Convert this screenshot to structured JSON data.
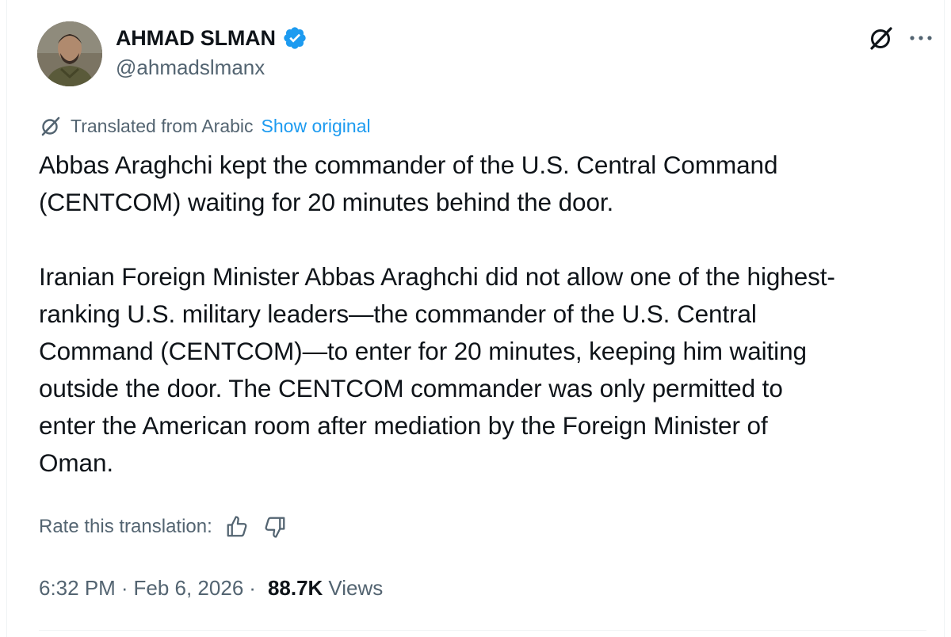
{
  "author": {
    "display_name": "AHMAD SLMAN",
    "handle": "@ahmadslmanx",
    "verified": true,
    "verified_color": "#1d9bf0"
  },
  "header_actions": {
    "grok_icon": "grok-icon",
    "more_icon": "more-horizontal-icon",
    "more_label": "···"
  },
  "translation": {
    "label": "Translated from Arabic",
    "show_original": "Show original"
  },
  "tweet": {
    "text": "Abbas Araghchi kept the commander of the U.S. Central Command\n(CENTCOM) waiting for 20 minutes behind the door.\n\nIranian Foreign Minister Abbas Araghchi did not allow one of the highest-\nranking U.S. military leaders—the commander of the U.S. Central\nCommand (CENTCOM)—to enter for 20 minutes, keeping him waiting\noutside the door. The CENTCOM commander was only permitted to\nenter the American room after mediation by the Foreign Minister of\nOman."
  },
  "rate": {
    "label": "Rate this translation:",
    "thumbs_up_icon": "thumbs-up-icon",
    "thumbs_down_icon": "thumbs-down-icon"
  },
  "meta": {
    "time": "6:32 PM",
    "separator": "·",
    "date": "Feb 6, 2026",
    "views_count": "88.7K",
    "views_label": "Views"
  },
  "colors": {
    "text_primary": "#0f1419",
    "text_secondary": "#536471",
    "link": "#1d9bf0",
    "divider": "#eff3f4"
  }
}
